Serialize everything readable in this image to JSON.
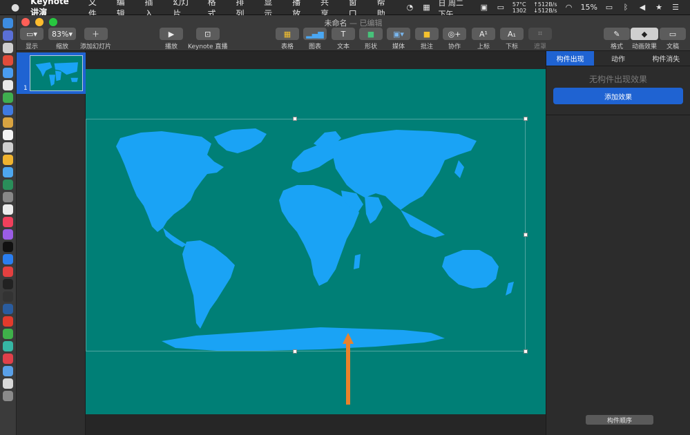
{
  "menubar": {
    "app_name": "Keynote 讲演",
    "items": [
      "文件",
      "编辑",
      "插入",
      "幻灯片",
      "格式",
      "排列",
      "显示",
      "播放",
      "共享",
      "窗口",
      "帮助"
    ],
    "datetime": "01月14日 周二 下午16:27:46",
    "cpu_temp": "57°C",
    "fan_rpm": "1302",
    "net_up": "↑512B/s",
    "net_down": "↓512B/s",
    "battery": "15%"
  },
  "window": {
    "title": "未命名",
    "title_suffix": " — 已编辑"
  },
  "toolbar": {
    "view_label": "显示",
    "zoom_value": "83%",
    "zoom_label": "缩放",
    "add_slide_label": "添加幻灯片",
    "play_label": "播放",
    "live_label": "Keynote 直播",
    "table_label": "表格",
    "chart_label": "图表",
    "text_label": "文本",
    "shape_label": "形状",
    "media_label": "媒体",
    "comment_label": "批注",
    "collab_label": "协作",
    "superscript_label": "上标",
    "subscript_label": "下标",
    "mask_label": "遮罩",
    "format_label": "格式",
    "animate_label": "动画效果",
    "document_label": "文稿"
  },
  "navigator": {
    "slide_number": "1"
  },
  "inspector": {
    "tabs": [
      "构件出现",
      "动作",
      "构件消失"
    ],
    "no_effect": "无构件出现效果",
    "add_effect": "添加效果",
    "build_order": "构件顺序"
  },
  "colors": {
    "accent": "#1f63d2",
    "slide_bg": "#007f76",
    "map": "#1aa3f5",
    "arrow": "#e9822c"
  }
}
